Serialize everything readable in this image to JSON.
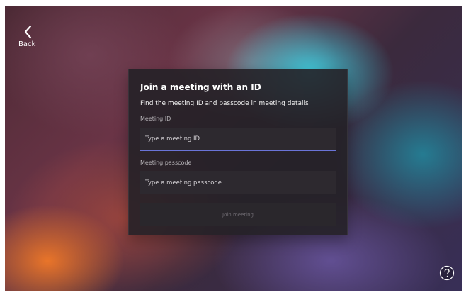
{
  "navigation": {
    "back_label": "Back",
    "back_icon": "chevron-left-icon"
  },
  "join_dialog": {
    "title": "Join a meeting with an ID",
    "subtitle": "Find the meeting ID and passcode in meeting details",
    "meeting_id": {
      "label": "Meeting ID",
      "value": "",
      "placeholder": "Type a meeting ID"
    },
    "meeting_passcode": {
      "label": "Meeting passcode",
      "value": "",
      "placeholder": "Type a meeting passcode"
    },
    "join_button_label": "Join meeting"
  },
  "help": {
    "icon": "question-mark-icon"
  },
  "colors": {
    "focus_accent": "#6a74d8",
    "dialog_background": "#252127"
  }
}
